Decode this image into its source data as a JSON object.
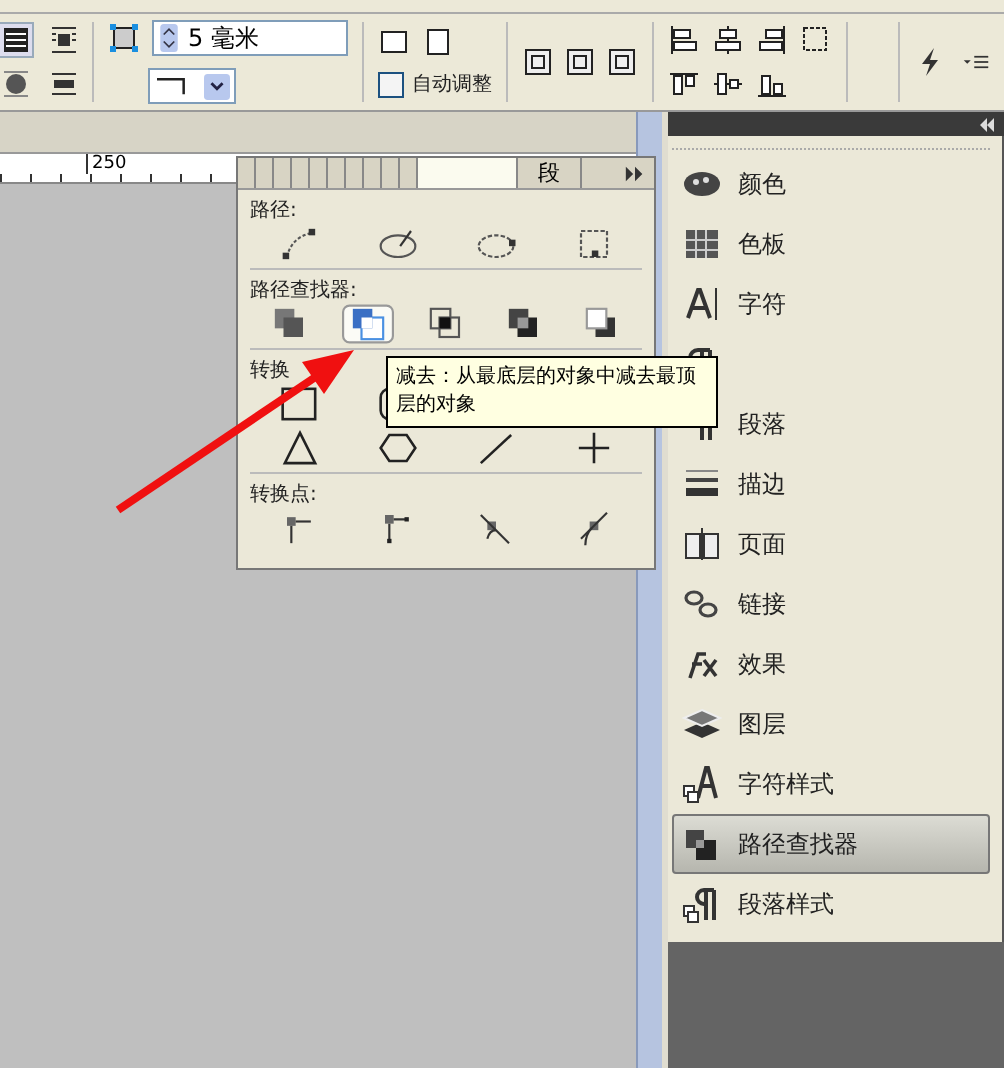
{
  "toolbar": {
    "stroke_weight": "5 毫米",
    "auto_fit": {
      "label": "自动调整",
      "checked": false
    }
  },
  "ruler": {
    "label": "250"
  },
  "pathfinder_panel": {
    "tabs": [
      {
        "selected": false
      },
      {
        "selected": false
      },
      {
        "selected": false
      },
      {
        "selected": false
      },
      {
        "selected": false
      },
      {
        "selected": false
      },
      {
        "selected": false
      },
      {
        "selected": false
      },
      {
        "selected": false
      },
      {
        "selected": false
      },
      {
        "selected": true
      },
      {
        "label": "段",
        "selected": false
      }
    ],
    "sections": [
      {
        "title": "路径:",
        "buttons": [
          {
            "kind": "join"
          },
          {
            "kind": "open"
          },
          {
            "kind": "close"
          },
          {
            "kind": "reverse"
          }
        ]
      },
      {
        "title": "路径查找器:",
        "buttons": [
          {
            "kind": "add",
            "selected": false
          },
          {
            "kind": "subtract",
            "selected": true
          },
          {
            "kind": "intersect",
            "selected": false
          },
          {
            "kind": "exclude",
            "selected": false
          },
          {
            "kind": "minus-back",
            "selected": false
          }
        ]
      },
      {
        "title": "转换",
        "buttons": [
          {
            "kind": "rect"
          },
          {
            "kind": "rounded"
          },
          {
            "kind": "triangle"
          },
          {
            "kind": "hexagon"
          },
          {
            "kind": "line"
          },
          {
            "kind": "plus"
          }
        ]
      },
      {
        "title": "转换点:",
        "buttons": [
          {
            "kind": "plain"
          },
          {
            "kind": "corner"
          },
          {
            "kind": "smooth"
          },
          {
            "kind": "symmetric"
          }
        ]
      }
    ]
  },
  "tooltip": "减去：从最底层的对象中减去最顶层的对象",
  "side_panel": {
    "items": [
      {
        "kind": "palette",
        "label": "颜色",
        "selected": false
      },
      {
        "kind": "swatches",
        "label": "色板",
        "selected": false
      },
      {
        "kind": "character",
        "label": "字符",
        "selected": false
      },
      {
        "kind": "paragraph",
        "selected": false
      },
      {
        "kind": "paragraph",
        "label": "段落",
        "selected": false
      },
      {
        "kind": "stroke",
        "label": "描边",
        "selected": false
      },
      {
        "kind": "pages",
        "label": "页面",
        "selected": false
      },
      {
        "kind": "links",
        "label": "链接",
        "selected": false
      },
      {
        "kind": "effects",
        "label": "效果",
        "selected": false
      },
      {
        "kind": "layers",
        "label": "图层",
        "selected": false
      },
      {
        "kind": "char-style",
        "label": "字符样式",
        "selected": false
      },
      {
        "kind": "pathfinder",
        "label": "路径查找器",
        "selected": true
      },
      {
        "kind": "para-style",
        "label": "段落样式",
        "selected": false
      }
    ]
  }
}
